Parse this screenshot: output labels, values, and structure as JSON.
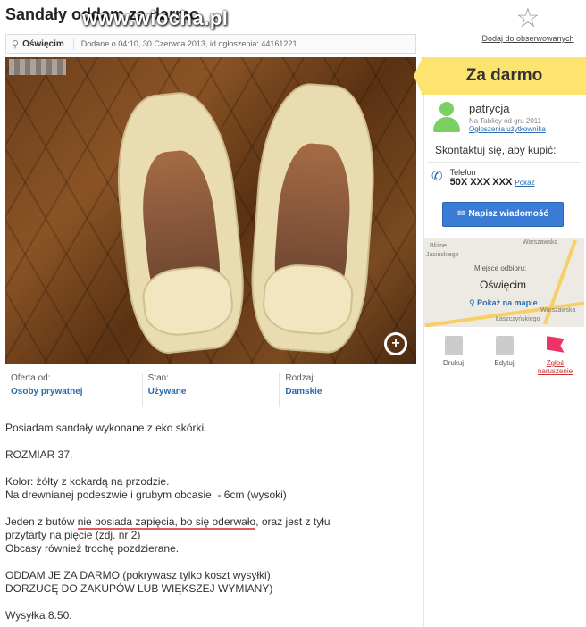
{
  "listing": {
    "title": "Sandały oddam za darmo",
    "watermark": "www.wiocha.pl",
    "location": "Oświęcim",
    "added": "Dodane o 04:10, 30 Czerwca 2013, id ogłoszenia: 44161221",
    "watch_label": "Dodaj do obserwowanych",
    "price": "Za darmo"
  },
  "specs": [
    {
      "label": "Oferta od:",
      "value": "Osoby prywatnej"
    },
    {
      "label": "Stan:",
      "value": "Używane"
    },
    {
      "label": "Rodzaj:",
      "value": "Damskie"
    }
  ],
  "description": {
    "p1": "Posiadam sandały wykonane z eko skórki.",
    "p2": "ROZMIAR 37.",
    "p3a": "Kolor: żółty z kokardą na przodzie.",
    "p3b": "Na drewnianej podeszwie i grubym obcasie. - 6cm (wysoki)",
    "p4a_pre": "Jeden z butów ",
    "p4a_hl": "nie posiada zapięcia, bo się oderwało",
    "p4a_post": ", oraz jest z tyłu",
    "p4b": "przytarty na pięcie (zdj. nr 2)",
    "p4c": "Obcasy również trochę pozdzierane.",
    "p5a": "ODDAM JE ZA DARMO (pokrywasz tylko koszt wysyłki).",
    "p5b": "DORZUCĘ DO ZAKUPÓW LUB WIĘKSZEJ WYMIANY)",
    "p6": "Wysyłka 8.50."
  },
  "seller": {
    "name": "patrycja",
    "since": "Na Tablicy od gru 2011",
    "ads_link": "Ogłoszenia użytkownika",
    "contact_heading": "Skontaktuj się, aby kupić:",
    "phone_label": "Telefon",
    "phone_value": "50X XXX XXX",
    "phone_show": "Pokaż",
    "message_button": "Napisz wiadomość"
  },
  "map": {
    "pickup_label": "Miejsce odbioru:",
    "pickup_city": "Oświęcim",
    "show_map": "Pokaż na mapie",
    "labels": [
      "Bliżne",
      "Jasińskiego",
      "Warszawska",
      "Łaszczyńskiego",
      "Warszawska"
    ]
  },
  "tools": {
    "print": "Drukuj",
    "edit": "Edytuj",
    "report": "Zgłoś naruszenie"
  },
  "colors": {
    "accent_blue": "#2b6aad",
    "price_bg": "#fde36f",
    "button_blue": "#3a7bd5",
    "highlight_underline": "#e35b5b"
  }
}
